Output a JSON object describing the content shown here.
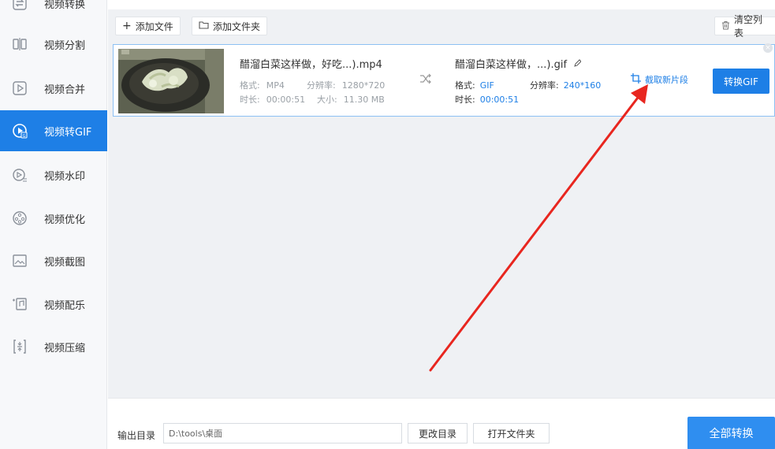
{
  "sidebar": {
    "items": [
      {
        "label": "视频转换",
        "icon": "convert-icon"
      },
      {
        "label": "视频分割",
        "icon": "split-icon"
      },
      {
        "label": "视频合并",
        "icon": "merge-icon"
      },
      {
        "label": "视频转GIF",
        "icon": "gif-icon"
      },
      {
        "label": "视频水印",
        "icon": "watermark-icon"
      },
      {
        "label": "视频优化",
        "icon": "optimize-icon"
      },
      {
        "label": "视频截图",
        "icon": "screenshot-icon"
      },
      {
        "label": "视频配乐",
        "icon": "music-icon"
      },
      {
        "label": "视频压缩",
        "icon": "compress-icon"
      }
    ],
    "active": "视频转GIF"
  },
  "toolbar": {
    "add_file": "添加文件",
    "add_folder": "添加文件夹",
    "clear_list": "清空列表"
  },
  "file": {
    "source_name": "醋溜白菜这样做，好吃...).mp4",
    "format_label": "格式:",
    "format_value": "MP4",
    "resolution_label": "分辨率:",
    "resolution_value": "1280*720",
    "duration_label": "时长:",
    "duration_value": "00:00:51",
    "size_label": "大小:",
    "size_value": "11.30 MB",
    "target_name": "醋溜白菜这样做，...).gif",
    "target_format_label": "格式:",
    "target_format_value": "GIF",
    "target_resolution_label": "分辨率:",
    "target_resolution_value": "240*160",
    "target_duration_label": "时长:",
    "target_duration_value": "00:00:51",
    "crop_label": "截取新片段",
    "convert_label": "转换GIF"
  },
  "output": {
    "label": "输出目录",
    "path": "D:\\tools\\桌面",
    "change_dir": "更改目录",
    "open_folder": "打开文件夹",
    "convert_all": "全部转换"
  },
  "colors": {
    "accent": "#1e7fe6",
    "annotation_arrow": "#e8261f"
  }
}
